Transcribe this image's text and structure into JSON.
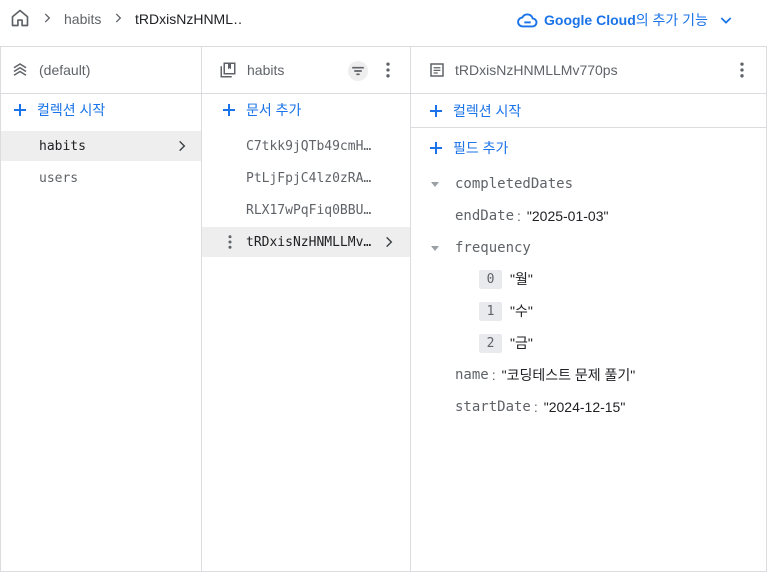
{
  "breadcrumb": {
    "items": [
      "habits",
      "tRDxisNzHNML…"
    ]
  },
  "cloud": {
    "brand": "Google Cloud",
    "suffix": "의 추가 기능"
  },
  "col1": {
    "title": "(default)",
    "add_label": "컬렉션 시작",
    "collections": [
      "habits",
      "users"
    ]
  },
  "col2": {
    "title": "habits",
    "add_label": "문서 추가",
    "documents": [
      "C7tkk9jQTb49cmH…",
      "PtLjFpjC4lz0zRA…",
      "RLX17wPqFiq0BBU…",
      "tRDxisNzHNMLLMv…"
    ]
  },
  "col3": {
    "title": "tRDxisNzHNMLLMv770ps",
    "add_collection_label": "컬렉션 시작",
    "add_field_label": "필드 추가",
    "fields": {
      "completedDates": "completedDates",
      "endDate_key": "endDate",
      "endDate_val": "\"2025-01-03\"",
      "frequency": "frequency",
      "freq_items": [
        {
          "i": "0",
          "v": "\"월\""
        },
        {
          "i": "1",
          "v": "\"수\""
        },
        {
          "i": "2",
          "v": "\"금\""
        }
      ],
      "name_key": "name",
      "name_val": "\"코딩테스트 문제 풀기\"",
      "startDate_key": "startDate",
      "startDate_val": "\"2024-12-15\""
    }
  },
  "colors": {
    "accent": "#1a73e8",
    "border": "#dadce0",
    "selected_bg": "#eeeeee"
  }
}
